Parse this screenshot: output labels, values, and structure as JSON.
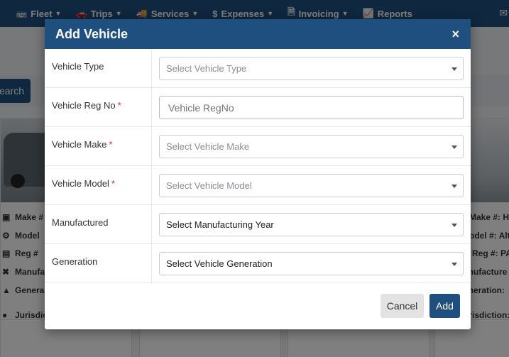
{
  "nav": {
    "items": [
      {
        "label": "Fleet",
        "icon": "bus-icon",
        "caret": true
      },
      {
        "label": "Trips",
        "icon": "car-icon",
        "caret": true
      },
      {
        "label": "Services",
        "icon": "truck-icon",
        "caret": true
      },
      {
        "label": "Expenses",
        "icon": "dollar-icon",
        "caret": true
      },
      {
        "label": "Invoicing",
        "icon": "invoice-icon",
        "caret": true
      },
      {
        "label": "Reports",
        "icon": "chart-icon",
        "caret": false
      }
    ]
  },
  "background": {
    "search_label": "earch",
    "card_left": {
      "rows": [
        {
          "icon": "factory-icon",
          "label": "Make #"
        },
        {
          "icon": "cogs-icon",
          "label": "Model"
        },
        {
          "icon": "id-card-icon",
          "label": "Reg #"
        },
        {
          "icon": "tools-icon",
          "label": "Manufa"
        },
        {
          "icon": "car-icon",
          "label": "Genera"
        },
        {
          "icon": "map-pin-icon",
          "label": "Jurisdicti"
        }
      ]
    },
    "card_right": {
      "rows": [
        {
          "label": "Make #:",
          "value": "Hyu"
        },
        {
          "label": "odel #:",
          "value": "Alt"
        },
        {
          "label": "Reg #:",
          "value": "PAK-"
        },
        {
          "label": "anufacture",
          "value": ""
        },
        {
          "label": "eneration:",
          "value": ""
        },
        {
          "label": "urisdiction:",
          "value": ""
        }
      ]
    }
  },
  "modal": {
    "title": "Add Vehicle",
    "close_symbol": "×",
    "fields": [
      {
        "label": "Vehicle Type",
        "required": false,
        "type": "select",
        "value": "Select Vehicle Type",
        "placeholder_style": true
      },
      {
        "label": "Vehicle Reg No",
        "required": true,
        "type": "text",
        "value": "",
        "placeholder": "Vehicle RegNo"
      },
      {
        "label": "Vehicle Make",
        "required": true,
        "type": "select",
        "value": "Select Vehicle Make",
        "placeholder_style": true
      },
      {
        "label": "Vehicle Model",
        "required": true,
        "type": "select",
        "value": "Select Vehicle Model",
        "placeholder_style": true
      },
      {
        "label": "Manufactured",
        "required": false,
        "type": "select",
        "value": "Select Manufacturing Year",
        "placeholder_style": false
      },
      {
        "label": "Generation",
        "required": false,
        "type": "select",
        "value": "Select Vehicle Generation",
        "placeholder_style": false
      }
    ],
    "required_mark": "*",
    "cancel_label": "Cancel",
    "add_label": "Add"
  },
  "colors": {
    "brand": "#1f4f7f",
    "required": "#d32f2f"
  }
}
